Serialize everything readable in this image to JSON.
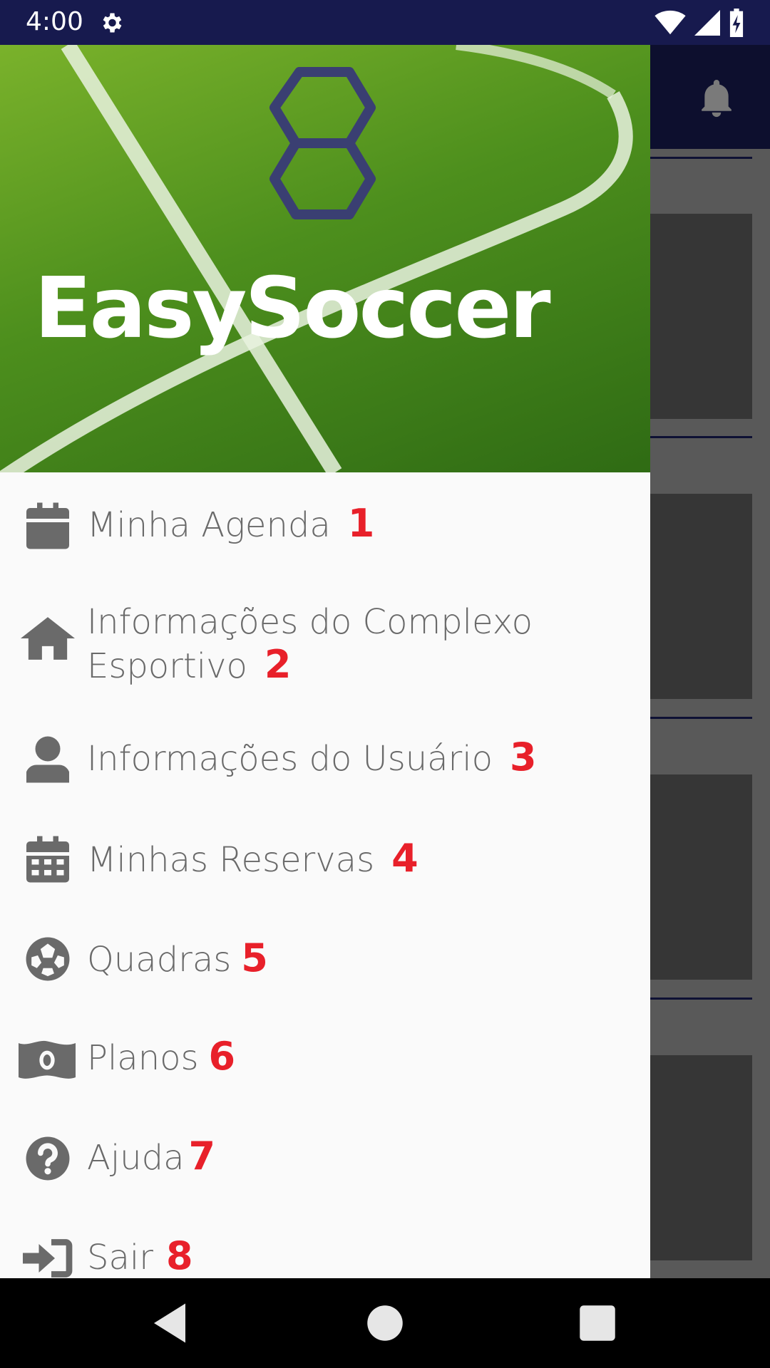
{
  "status_bar": {
    "time": "4:00",
    "icons": [
      "settings-icon",
      "wifi-icon",
      "signal-icon",
      "battery-charging-icon"
    ]
  },
  "header": {
    "brand_name": "EasySoccer",
    "logo": "hexagon-s-logo",
    "colors": {
      "logo": "#3a3f72",
      "grass": "#4d8f1d"
    }
  },
  "menu": {
    "items": [
      {
        "label": "Minha Agenda",
        "number": "1",
        "icon": "calendar-icon"
      },
      {
        "label": "Informações do Complexo",
        "label_line2": "Esportivo",
        "number": "2",
        "icon": "home-icon"
      },
      {
        "label": "Informações do Usuário",
        "number": "3",
        "icon": "user-icon"
      },
      {
        "label": "Minhas Reservas",
        "number": "4",
        "icon": "calendar-grid-icon"
      },
      {
        "label": "Quadras",
        "number": "5",
        "icon": "soccer-ball-icon"
      },
      {
        "label": "Planos",
        "number": "6",
        "icon": "money-icon"
      },
      {
        "label": "Ajuda",
        "number": "7",
        "icon": "help-icon"
      },
      {
        "label": "Sair",
        "number": "8",
        "icon": "sign-out-icon"
      }
    ],
    "colors": {
      "text": "#6a6a6a",
      "number": "#e8202a"
    }
  },
  "nav": {
    "buttons": [
      "back-icon",
      "home-icon",
      "recents-icon"
    ]
  }
}
